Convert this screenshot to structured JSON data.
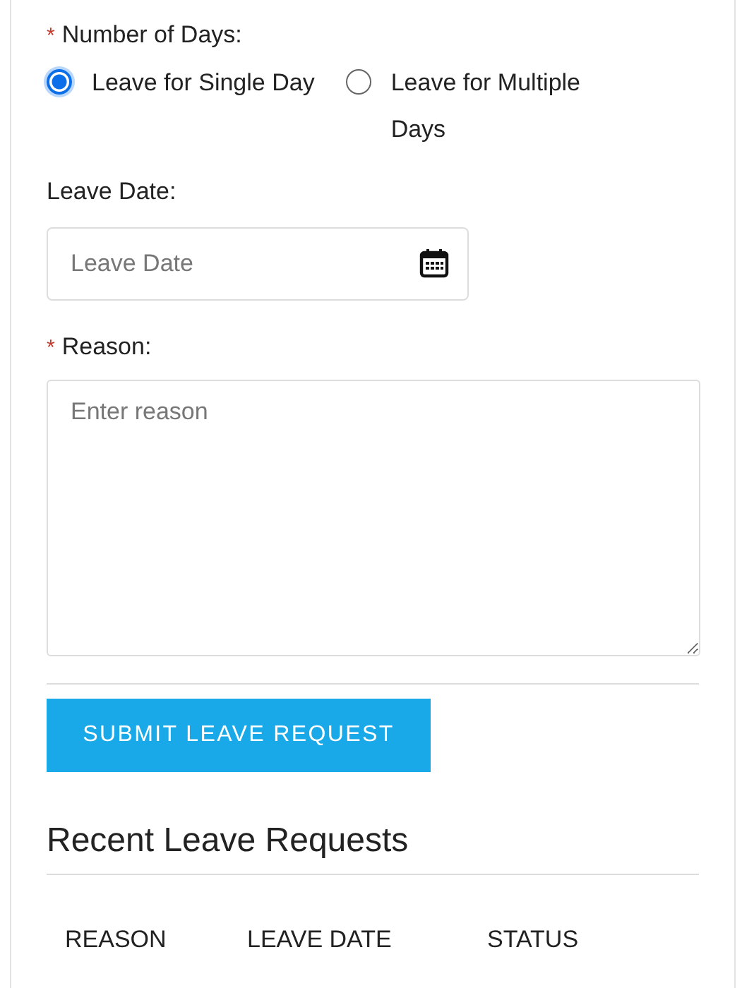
{
  "form": {
    "fields": [
      {
        "kind": "radio-group",
        "required_mark": "*",
        "label": "Number of Days:",
        "options": [
          {
            "label": "Leave for Single Day",
            "selected": true
          },
          {
            "label": "Leave for Multiple Days",
            "selected": false
          }
        ]
      },
      {
        "kind": "date",
        "label": "Leave Date:",
        "placeholder": "Leave Date"
      },
      {
        "kind": "textarea",
        "required_mark": "*",
        "label": "Reason:",
        "placeholder": "Enter reason"
      }
    ],
    "submit_button": "SUBMIT LEAVE REQUEST"
  },
  "recent": {
    "title": "Recent Leave Requests",
    "columns": [
      "REASON",
      "LEAVE DATE",
      "STATUS"
    ]
  }
}
